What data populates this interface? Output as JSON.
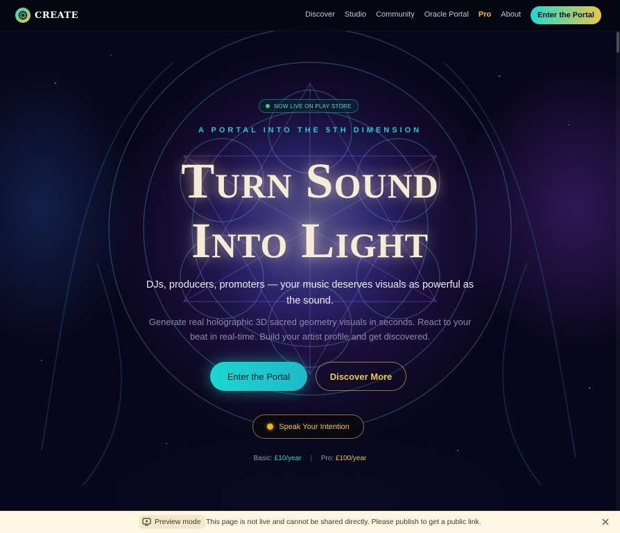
{
  "nav": {
    "logo_text": "CREATE",
    "links": [
      "Discover",
      "Studio",
      "Community",
      "Oracle Portal",
      "Pro",
      "About"
    ],
    "cta_label": "Enter the Portal"
  },
  "hero": {
    "badge": "NOW LIVE ON PLAY STORE",
    "tagline": "A PORTAL INTO THE 5TH DIMENSION",
    "title_line1": "Turn Sound",
    "title_line2": "Into Light",
    "subtitle": "DJs, producers, promoters — your music deserves visuals as powerful as the sound.",
    "description": "Generate real holographic 3D sacred geometry visuals in seconds. React to your beat in real-time. Build your artist profile and get discovered.",
    "primary_button": "Enter the Portal",
    "secondary_button": "Discover More",
    "intention_button": "Speak Your Intention"
  },
  "pricing": {
    "basic_label": "Basic:",
    "basic_price": "£10/year",
    "separator": "|",
    "pro_label": "Pro:",
    "pro_price": "£100/year"
  },
  "preview_bar": {
    "chip_label": "Preview mode",
    "message": "This page is not live and cannot be shared directly. Please publish to get a public link."
  },
  "colors": {
    "accent_teal": "#1dd6cf",
    "accent_gold": "#e9c35a",
    "pro_gold": "#f0c02c",
    "background": "#07061a"
  },
  "icons": {
    "logo": "logo-icon",
    "live": "live-dot-icon",
    "intention": "intention-dot-icon",
    "preview": "preview-icon",
    "close": "close-icon"
  }
}
